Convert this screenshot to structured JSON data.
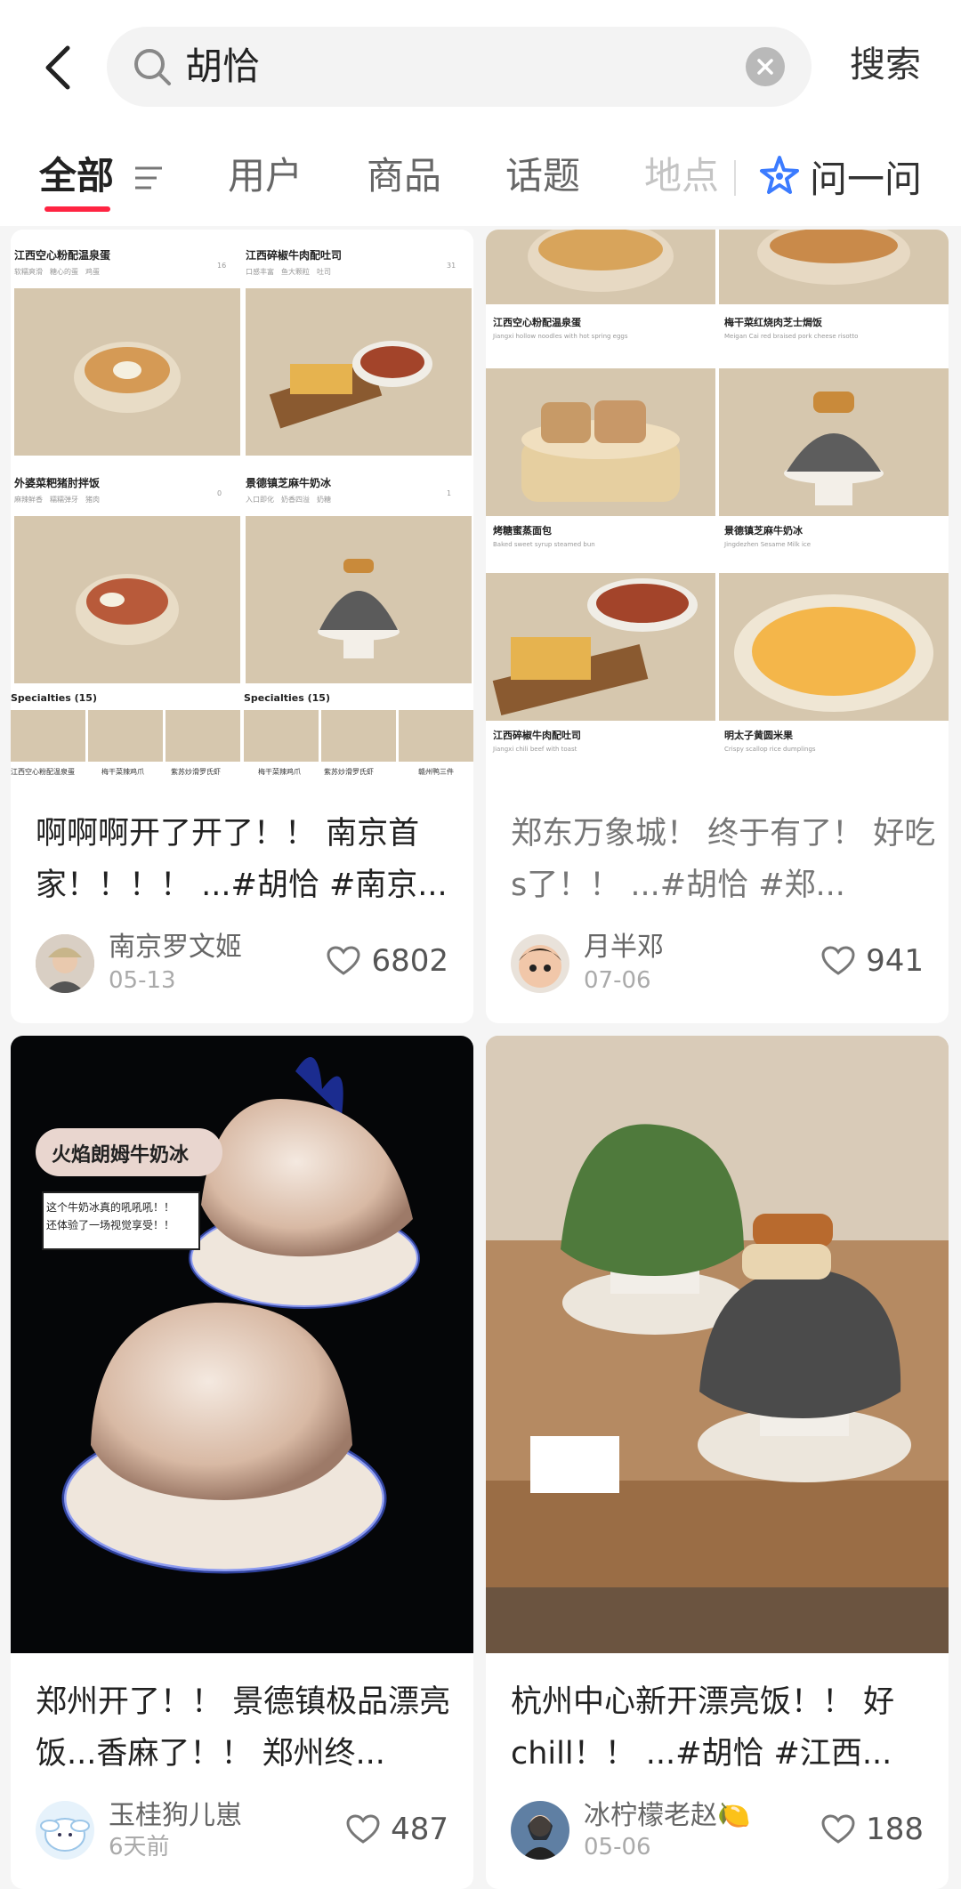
{
  "search": {
    "query": "胡恰",
    "button": "搜索"
  },
  "tabs": [
    {
      "label": "全部"
    },
    {
      "label": "用户"
    },
    {
      "label": "商品"
    },
    {
      "label": "话题"
    },
    {
      "label": "地点"
    }
  ],
  "ask_label": "问一问",
  "colors": {
    "accent": "#ff2442",
    "background": "#f5f5f5",
    "card": "#ffffff"
  },
  "cards": [
    {
      "title": "啊啊啊开了开了！！ 南京首家！！！！ ...#胡恰 #南京...",
      "author": "南京罗文姬",
      "date": "05-13",
      "likes": "6802",
      "image": {
        "items": [
          {
            "name": "江西空心粉配温泉蛋",
            "tags": "软糯爽滑　糖心的蛋　鸡蛋",
            "count": "16"
          },
          {
            "name": "江西碎椒牛肉配吐司",
            "tags": "口感丰富　鱼大颗粒　吐司",
            "count": "31"
          },
          {
            "name": "外婆菜粑猪肘拌饭",
            "tags": "麻辣鲜香　糯糯弹牙　猪肉",
            "count": "0"
          },
          {
            "name": "景德镇芝麻牛奶冰",
            "tags": "入口即化　奶香四溢　奶糖",
            "count": "1"
          }
        ],
        "specialties_label": "Specialties (15)",
        "strip": [
          "江西空心粉配温泉蛋",
          "梅干菜辣鸡爪",
          "紫苏炒滑罗氏虾",
          "梅干菜辣鸡爪",
          "紫苏炒滑罗氏虾",
          "赣州鸭三件"
        ]
      }
    },
    {
      "title": "郑东万象城！ 终于有了！ 好吃s了！！ ...#胡恰 #郑...",
      "author": "月半邓",
      "date": "07-06",
      "likes": "941",
      "image": {
        "items": [
          {
            "name": "江西空心粉配温泉蛋",
            "sub": "Jiangxi hollow noodles with hot spring eggs"
          },
          {
            "name": "梅干菜红烧肉芝士焗饭",
            "sub": "Meigan Cai red braised pork cheese risotto"
          },
          {
            "name": "烤糖蜜蒸面包",
            "sub": "Baked sweet syrup steamed bun"
          },
          {
            "name": "景德镇芝麻牛奶冰",
            "sub": "Jingdezhen Sesame Milk ice"
          },
          {
            "name": "江西碎椒牛肉配吐司",
            "sub": "Jiangxi chili beef with toast"
          },
          {
            "name": "明太子黄圆米果",
            "sub": "Crispy scallop rice dumplings"
          }
        ]
      }
    },
    {
      "title": "郑州开了！！ 景德镇极品漂亮饭...香麻了！！ 郑州终...",
      "author": "玉桂狗儿崽",
      "date": "6天前",
      "likes": "487",
      "image": {
        "badge": "火焰朗姆牛奶冰",
        "note_line1": "这个牛奶冰真的吼吼吼！！",
        "note_line2": "还体验了一场视觉享受！！"
      }
    },
    {
      "title": "杭州中心新开漂亮饭！！ 好chill！！ ...#胡恰 #江西...",
      "author": "冰柠檬老赵🍋",
      "date": "05-06",
      "likes": "188"
    }
  ]
}
